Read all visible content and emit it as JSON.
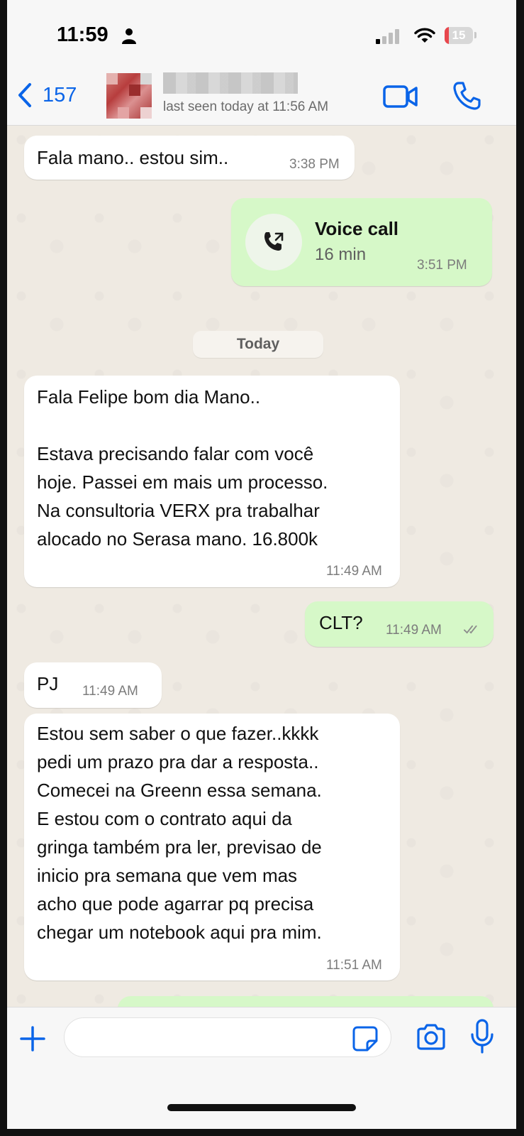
{
  "status_bar": {
    "time": "11:59",
    "battery": "15",
    "battery_level": 0.15
  },
  "header": {
    "back_count": "157",
    "last_seen": "last seen today at 11:56 AM"
  },
  "messages": [
    {
      "direction": "in",
      "text": "Fala mano..  estou sim..",
      "time": "3:38 PM"
    },
    {
      "direction": "out",
      "type": "voice_call",
      "title": "Voice call",
      "duration": "16 min",
      "time": "3:51 PM"
    },
    {
      "type": "date",
      "text": "Today"
    },
    {
      "direction": "in",
      "text": "Fala Felipe bom dia Mano..\n\nEstava precisando falar com você\nhoje. Passei em mais um processo.\nNa consultoria VERX pra trabalhar\nalocado no Serasa mano. 16.800k",
      "time": "11:49 AM"
    },
    {
      "direction": "out",
      "text": "CLT?",
      "time": "11:49 AM",
      "status": "read"
    },
    {
      "direction": "in",
      "text": "PJ",
      "time": "11:49 AM"
    },
    {
      "direction": "in",
      "text": "Estou sem saber o que fazer..kkkk\npedi um prazo pra dar a resposta..\nComecei na Greenn essa semana.\nE estou com o contrato aqui da\ngringa também pra ler, previsao de\ninicio pra semana que vem mas\nacho que pode agarrar pq precisa\nchegar um notebook aqui pra mim.",
      "time": "11:51 AM"
    }
  ],
  "input_bar": {
    "placeholder": ""
  },
  "icons": {
    "back": "chevron-left-icon",
    "video": "video-camera-icon",
    "call": "phone-icon",
    "voice_call": "outgoing-call-icon",
    "read_receipt": "double-check-icon",
    "plus": "plus-icon",
    "sticker": "sticker-icon",
    "camera": "camera-icon",
    "mic": "microphone-icon"
  },
  "colors": {
    "accent": "#0a64e8",
    "incoming_bubble": "#ffffff",
    "outgoing_bubble": "#d6f8c8",
    "chat_background": "#efeae2",
    "battery_low": "#e8474d"
  }
}
